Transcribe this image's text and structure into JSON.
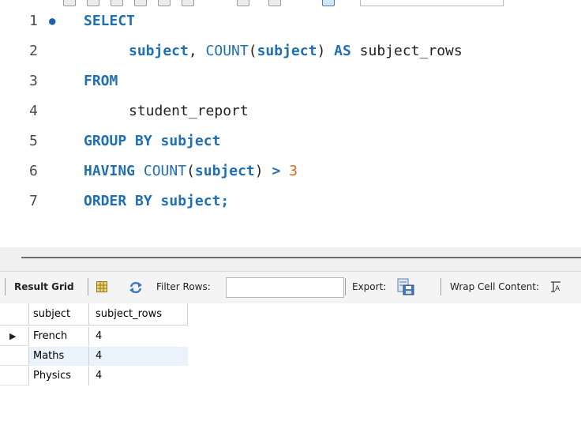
{
  "editor": {
    "lines": [
      {
        "number": "1",
        "marker": "●"
      },
      {
        "number": "2"
      },
      {
        "number": "3"
      },
      {
        "number": "4"
      },
      {
        "number": "5"
      },
      {
        "number": "6"
      },
      {
        "number": "7"
      }
    ],
    "tokens": {
      "select": "SELECT",
      "subject_col": "subject",
      "comma": ",",
      "count_fn": "COUNT",
      "paren_open": "(",
      "count_arg": "subject",
      "paren_close": ")",
      "as_kw": "AS",
      "alias": "subject_rows",
      "from": "FROM",
      "table": "student_report",
      "group_by": "GROUP BY",
      "group_col": "subject",
      "having": "HAVING",
      "having_fn": "COUNT",
      "having_open": "(",
      "having_arg": "subject",
      "having_close": ")",
      "gt": ">",
      "threshold": "3",
      "order_by": "ORDER BY",
      "order_col": "subject",
      "semicolon": ";"
    }
  },
  "result_toolbar": {
    "result_grid_label": "Result Grid",
    "filter_label": "Filter Rows:",
    "filter_value": "",
    "export_label": "Export:",
    "wrap_label": "Wrap Cell Content:",
    "icons": [
      "grid-layout-icon",
      "refresh-icon",
      "export-icon",
      "wrap-cell-icon"
    ]
  },
  "grid": {
    "columns": [
      "subject",
      "subject_rows"
    ],
    "rows": [
      {
        "subject": "French",
        "subject_rows": "4",
        "selected": true
      },
      {
        "subject": "Maths",
        "subject_rows": "4"
      },
      {
        "subject": "Physics",
        "subject_rows": "4"
      }
    ],
    "current_row_marker": "▶"
  },
  "colors": {
    "keyword": "#1f6fb2",
    "number": "#d2691e",
    "alt_row": "#eaf2fb"
  }
}
